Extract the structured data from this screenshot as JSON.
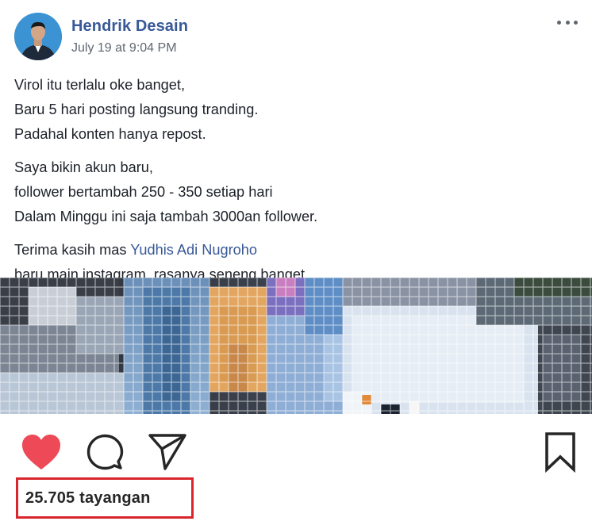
{
  "post": {
    "author": "Hendrik Desain",
    "timestamp": "July 19 at 9:04 PM",
    "paragraph1": {
      "line1": "Virol itu terlalu oke banget,",
      "line2": "Baru 5 hari posting langsung tranding.",
      "line3": "Padahal konten hanya repost."
    },
    "paragraph2": {
      "line1": "Saya bikin akun baru,",
      "line2": "follower bertambah 250 - 350 setiap hari",
      "line3": "Dalam Minggu ini saja tambah 3000an follower."
    },
    "paragraph3": {
      "line1_prefix": "Terima kasih mas ",
      "mention": "Yudhis Adi Nugroho",
      "line2": "baru main instagram, rasanya seneng banget"
    }
  },
  "instagram": {
    "views": "25.705 tayangan"
  },
  "icons": {
    "more": "more-horizontal-icon",
    "like": "heart-icon",
    "comment": "comment-icon",
    "share": "send-icon",
    "save": "bookmark-icon"
  },
  "colors": {
    "author_link": "#385898",
    "like_heart": "#ed4956",
    "highlight_box": "#d9252b",
    "text": "#1d2129",
    "muted": "#616770"
  }
}
